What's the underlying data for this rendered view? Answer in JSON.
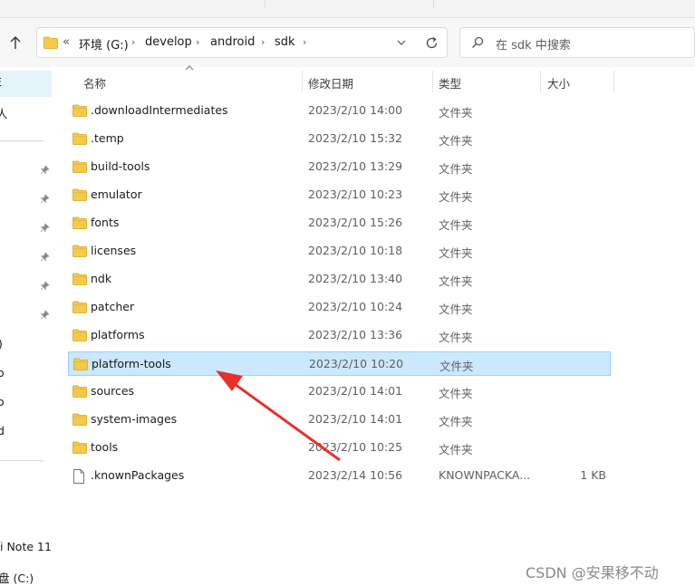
{
  "address": {
    "overflow": "«",
    "crumbs": [
      "环境 (G:)",
      "develop",
      "android",
      "sdk"
    ]
  },
  "search": {
    "placeholder": "在 sdk 中搜索"
  },
  "columns": {
    "name": "名称",
    "date": "修改日期",
    "type": "类型",
    "size": "大小"
  },
  "nav": {
    "items": [
      "E",
      "人",
      ")",
      "o",
      "o",
      "d",
      "i Note 11",
      "盘 (C:)"
    ]
  },
  "files": [
    {
      "name": ".downloadIntermediates",
      "date": "2023/2/10 14:00",
      "type": "文件夹",
      "size": "",
      "kind": "folder"
    },
    {
      "name": ".temp",
      "date": "2023/2/10 15:32",
      "type": "文件夹",
      "size": "",
      "kind": "folder"
    },
    {
      "name": "build-tools",
      "date": "2023/2/10 13:29",
      "type": "文件夹",
      "size": "",
      "kind": "folder"
    },
    {
      "name": "emulator",
      "date": "2023/2/10 10:23",
      "type": "文件夹",
      "size": "",
      "kind": "folder"
    },
    {
      "name": "fonts",
      "date": "2023/2/10 15:26",
      "type": "文件夹",
      "size": "",
      "kind": "folder"
    },
    {
      "name": "licenses",
      "date": "2023/2/10 10:18",
      "type": "文件夹",
      "size": "",
      "kind": "folder"
    },
    {
      "name": "ndk",
      "date": "2023/2/10 13:40",
      "type": "文件夹",
      "size": "",
      "kind": "folder"
    },
    {
      "name": "patcher",
      "date": "2023/2/10 10:24",
      "type": "文件夹",
      "size": "",
      "kind": "folder"
    },
    {
      "name": "platforms",
      "date": "2023/2/10 13:36",
      "type": "文件夹",
      "size": "",
      "kind": "folder"
    },
    {
      "name": "platform-tools",
      "date": "2023/2/10 10:20",
      "type": "文件夹",
      "size": "",
      "kind": "folder",
      "selected": true
    },
    {
      "name": "sources",
      "date": "2023/2/10 14:01",
      "type": "文件夹",
      "size": "",
      "kind": "folder"
    },
    {
      "name": "system-images",
      "date": "2023/2/10 14:01",
      "type": "文件夹",
      "size": "",
      "kind": "folder"
    },
    {
      "name": "tools",
      "date": "2023/2/10 10:25",
      "type": "文件夹",
      "size": "",
      "kind": "folder"
    },
    {
      "name": ".knownPackages",
      "date": "2023/2/14 10:56",
      "type": "KNOWNPACKA...",
      "size": "1 KB",
      "kind": "file"
    }
  ],
  "watermark": "CSDN @安果移不动",
  "colors": {
    "selection": "#cce8ff",
    "selection_border": "#99d1ff",
    "folder": "#f7c948",
    "arrow": "#e8302a"
  },
  "icons": [
    "up-arrow-icon",
    "folder-icon",
    "chevron-right-icon",
    "chevron-down-icon",
    "refresh-icon",
    "search-icon",
    "pin-icon",
    "file-icon",
    "sort-up-icon"
  ]
}
